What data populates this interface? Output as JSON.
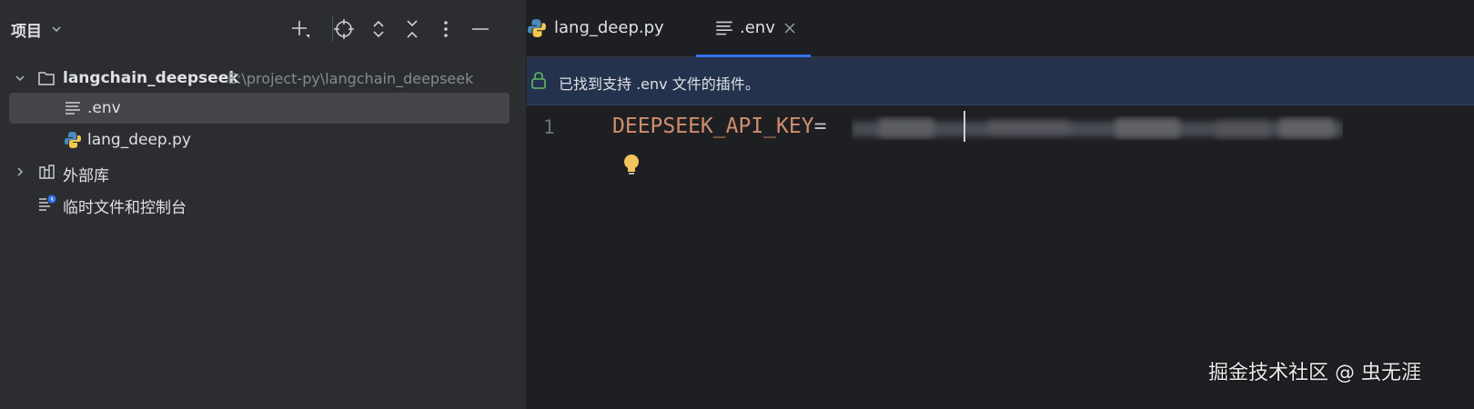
{
  "project_panel": {
    "title": "项目",
    "tree": {
      "root": {
        "name": "langchain_deepseek",
        "path": "E:\\project-py\\langchain_deepseek"
      },
      "files": [
        {
          "name": ".env",
          "selected": true,
          "icon": "text-file-icon"
        },
        {
          "name": "lang_deep.py",
          "selected": false,
          "icon": "python-file-icon"
        }
      ],
      "external_libraries": "外部库",
      "scratches": "临时文件和控制台"
    }
  },
  "editor": {
    "tabs": [
      {
        "label": "lang_deep.py",
        "icon": "python-file-icon",
        "active": false
      },
      {
        "label": ".env",
        "icon": "text-file-icon",
        "active": true
      }
    ],
    "notice": "已找到支持 .env 文件的插件。",
    "line_number": "1",
    "code": {
      "key": "DEEPSEEK_API_KEY",
      "eq": "="
    }
  },
  "watermark": "掘金技术社区 @ 虫无涯",
  "colors": {
    "panel_bg": "#2b2d30",
    "editor_bg": "#1e1f22",
    "accent": "#3574f0",
    "code_key": "#cf8e6d",
    "notice_bg": "#25324d"
  }
}
